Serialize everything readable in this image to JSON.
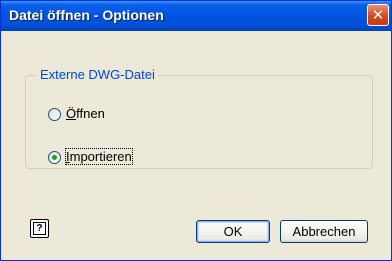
{
  "dialog": {
    "title": "Datei öffnen - Optionen",
    "close_glyph": "✕"
  },
  "group": {
    "legend": "Externe DWG-Datei",
    "options": [
      {
        "label_accel": "Ö",
        "label_rest": "ffnen",
        "selected": false
      },
      {
        "label_accel": "I",
        "label_rest": "mportieren",
        "selected": true
      }
    ]
  },
  "buttons": {
    "help_glyph": "?",
    "ok_label": "OK",
    "cancel_label": "Abbrechen"
  },
  "colors": {
    "titlebar": "#0054e3",
    "group_legend": "#0046d5",
    "radio_dot": "#21a121"
  }
}
